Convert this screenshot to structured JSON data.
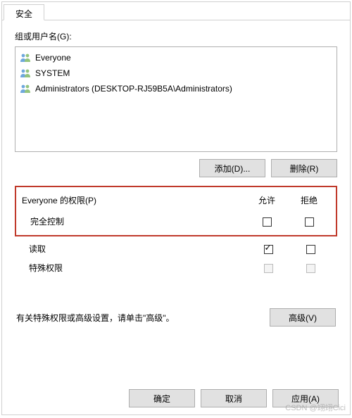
{
  "tab_label": "安全",
  "groups_label": "组或用户名(G):",
  "users": [
    {
      "name": "Everyone"
    },
    {
      "name": "SYSTEM"
    },
    {
      "name": "Administrators (DESKTOP-RJ59B5A\\Administrators)"
    }
  ],
  "add_btn": "添加(D)...",
  "remove_btn": "删除(R)",
  "perm_title": "Everyone 的权限(P)",
  "allow_label": "允许",
  "deny_label": "拒绝",
  "perms": {
    "full_control": "完全控制",
    "read": "读取",
    "special": "特殊权限"
  },
  "advanced_text": "有关特殊权限或高级设置，请单击\"高级\"。",
  "advanced_btn": "高级(V)",
  "ok_btn": "确定",
  "cancel_btn": "取消",
  "apply_btn": "应用(A)",
  "watermark": "CSDN @翊翊Cici"
}
